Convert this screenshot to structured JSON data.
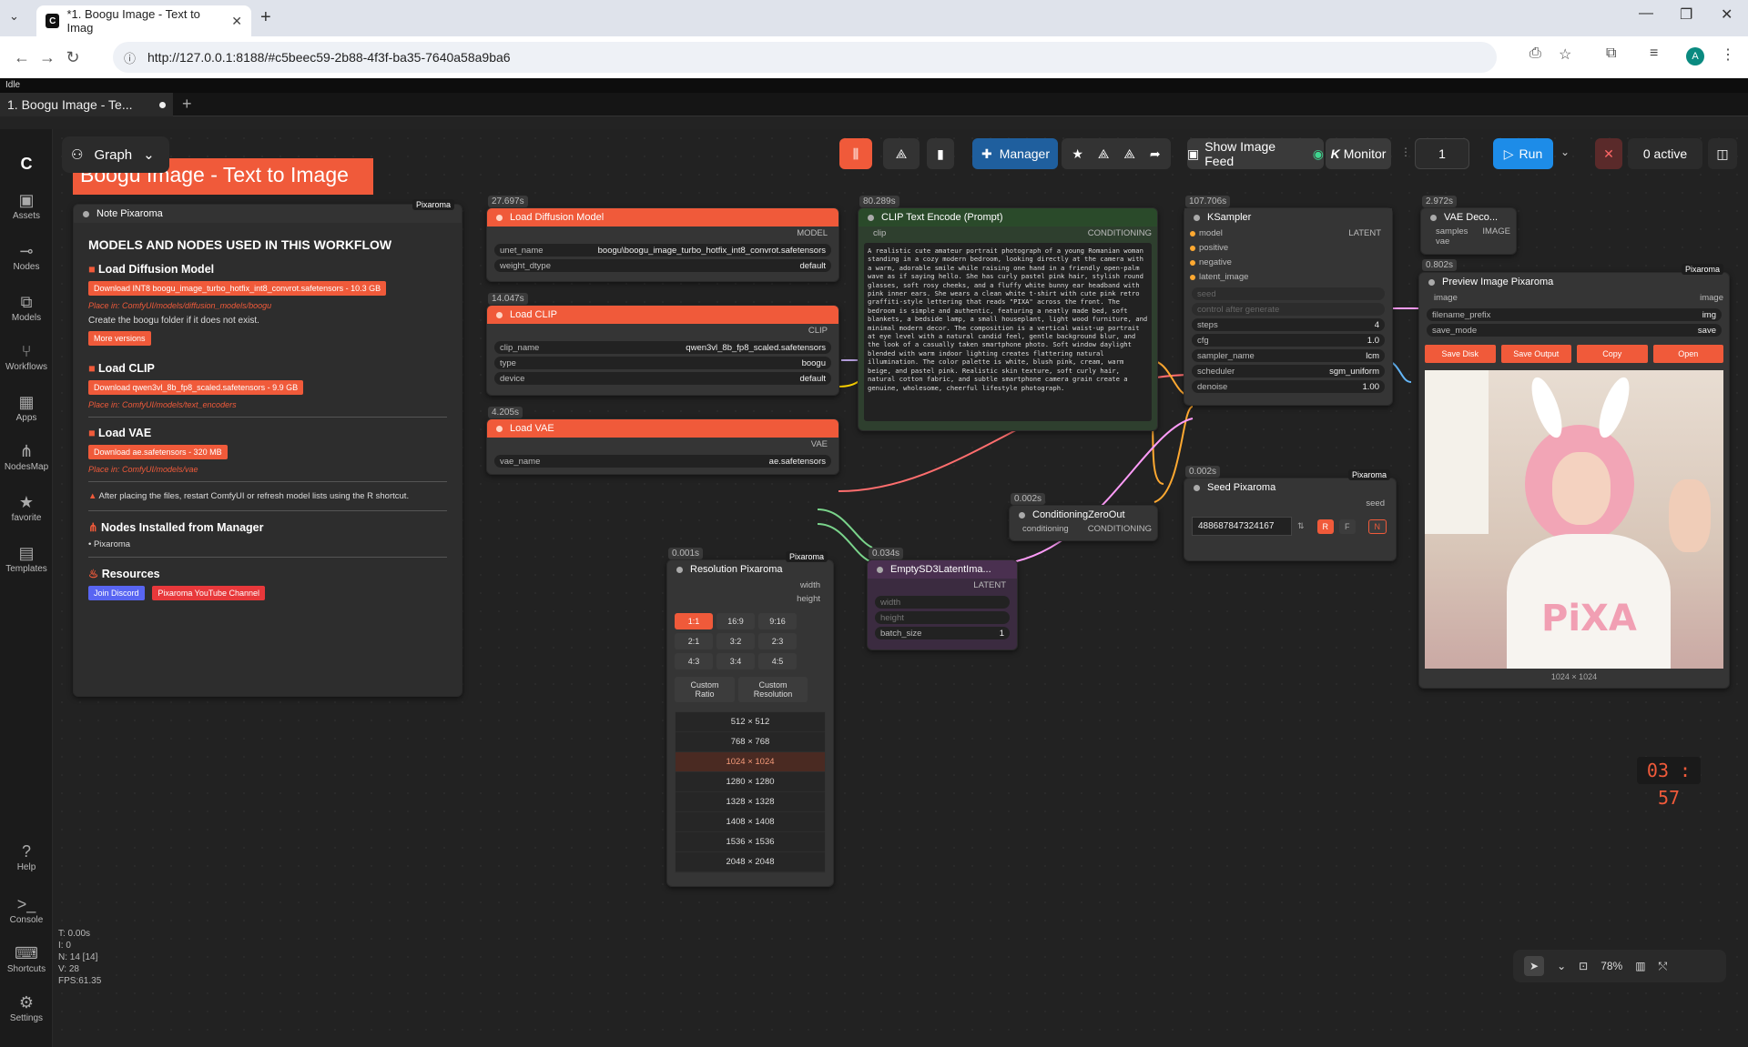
{
  "browser": {
    "tab_title": "*1. Boogu Image - Text to Imag",
    "url": "http://127.0.0.1:8188/#c5beec59-2b88-4f3f-ba35-7640a58a9ba6",
    "profile_initial": "A"
  },
  "app": {
    "status": "Idle",
    "workflow_tab": "1. Boogu Image - Te...",
    "mode": "Graph",
    "group_title": "Boogu Image - Text to Image"
  },
  "sidebar": [
    {
      "label": "Assets",
      "icon": "assets-icon"
    },
    {
      "label": "Nodes",
      "icon": "nodes-icon"
    },
    {
      "label": "Models",
      "icon": "models-icon"
    },
    {
      "label": "Workflows",
      "icon": "workflows-icon"
    },
    {
      "label": "Apps",
      "icon": "apps-icon"
    },
    {
      "label": "NodesMap",
      "icon": "nodesmap-icon"
    },
    {
      "label": "favorite",
      "icon": "star-icon"
    },
    {
      "label": "Templates",
      "icon": "templates-icon"
    },
    {
      "label": "Help",
      "icon": "help-icon"
    },
    {
      "label": "Console",
      "icon": "console-icon"
    },
    {
      "label": "Shortcuts",
      "icon": "keyboard-icon"
    },
    {
      "label": "Settings",
      "icon": "gear-icon"
    }
  ],
  "toolbar": {
    "manager": "Manager",
    "show_feed": "Show Image Feed",
    "monitor": "Monitor",
    "queue_count": "1",
    "run": "Run",
    "active": "0 active"
  },
  "note": {
    "title": "Note Pixaroma",
    "badge": "Pixaroma",
    "heading": "MODELS AND NODES USED IN THIS WORKFLOW",
    "s1_title": "Load Diffusion Model",
    "s1_dl": "Download INT8 boogu_image_turbo_hotfix_int8_convrot.safetensors - 10.3 GB",
    "s1_place": "Place in: ComfyUI/models/diffusion_models/boogu",
    "s1_create": "Create the  boogu  folder if it does not exist.",
    "s1_more": "More versions",
    "s2_title": "Load CLIP",
    "s2_dl": "Download qwen3vl_8b_fp8_scaled.safetensors - 9.9 GB",
    "s2_place": "Place in: ComfyUI/models/text_encoders",
    "s3_title": "Load VAE",
    "s3_dl": "Download ae.safetensors - 320 MB",
    "s3_place": "Place in: ComfyUI/models/vae",
    "warn": "After placing the files, restart ComfyUI or refresh model lists using the R shortcut.",
    "s4_title": "Nodes Installed from Manager",
    "s4_item": "Pixaroma",
    "s5_title": "Resources",
    "discord": "Join Discord",
    "youtube": "Pixaroma YouTube Channel"
  },
  "nodes": {
    "diff": {
      "time": "27.697s",
      "title": "Load Diffusion Model",
      "out": "MODEL",
      "w1_name": "unet_name",
      "w1_val": "boogu\\boogu_image_turbo_hotfix_int8_convrot.safetensors",
      "w2_name": "weight_dtype",
      "w2_val": "default"
    },
    "clip": {
      "time": "14.047s",
      "title": "Load CLIP",
      "out": "CLIP",
      "w1_name": "clip_name",
      "w1_val": "qwen3vl_8b_fp8_scaled.safetensors",
      "w2_name": "type",
      "w2_val": "boogu",
      "w3_name": "device",
      "w3_val": "default"
    },
    "vae": {
      "time": "4.205s",
      "title": "Load VAE",
      "out": "VAE",
      "w1_name": "vae_name",
      "w1_val": "ae.safetensors"
    },
    "enc": {
      "time": "80.289s",
      "title": "CLIP Text Encode (Prompt)",
      "in": "clip",
      "out": "CONDITIONING",
      "prompt": "A realistic cute amateur portrait photograph of a young Romanian woman standing in a cozy modern bedroom, looking directly at the camera with a warm, adorable smile while raising one hand in a friendly open-palm wave as if saying hello. She has curly pastel pink hair, stylish round glasses, soft rosy cheeks, and a fluffy white bunny ear headband with pink inner ears. She wears a clean white t-shirt with cute pink retro graffiti-style lettering that reads \"PIXA\" across the front. The bedroom is simple and authentic, featuring a neatly made bed, soft blankets, a bedside lamp, a small houseplant, light wood furniture, and minimal modern decor. The composition is a vertical waist-up portrait at eye level with a natural candid feel, gentle background blur, and the look of a casually taken smartphone photo. Soft window daylight blended with warm indoor lighting creates flattering natural illumination. The color palette is white, blush pink, cream, warm beige, and pastel pink. Realistic skin texture, soft curly hair, natural cotton fabric, and subtle smartphone camera grain create a genuine, wholesome, cheerful lifestyle photograph."
    },
    "ks": {
      "time": "107.706s",
      "title": "KSampler",
      "out": "LATENT",
      "in1": "model",
      "in2": "positive",
      "in3": "negative",
      "in4": "latent_image",
      "seed": "seed",
      "cag": "control after generate",
      "steps_n": "steps",
      "steps_v": "4",
      "cfg_n": "cfg",
      "cfg_v": "1.0",
      "samp_n": "sampler_name",
      "samp_v": "lcm",
      "sch_n": "scheduler",
      "sch_v": "sgm_uniform",
      "den_n": "denoise",
      "den_v": "1.00"
    },
    "vaed": {
      "time": "2.972s",
      "title": "VAE Deco...",
      "in1": "samples",
      "in2": "vae",
      "out": "IMAGE"
    },
    "prev": {
      "time": "0.802s",
      "badge": "Pixaroma",
      "title": "Preview Image Pixaroma",
      "in": "image",
      "out": "image",
      "w1_name": "filename_prefix",
      "w1_val": "img",
      "w2_name": "save_mode",
      "w2_val": "save",
      "b1": "Save Disk",
      "b2": "Save Output",
      "b3": "Copy",
      "b4": "Open",
      "caption": "1024 × 1024"
    },
    "seed": {
      "time": "0.002s",
      "badge": "Pixaroma",
      "title": "Seed Pixaroma",
      "out": "seed",
      "value": "488687847324167",
      "r": "R",
      "f": "F",
      "n": "N"
    },
    "czo": {
      "time": "0.002s",
      "title": "ConditioningZeroOut",
      "in": "conditioning",
      "out": "CONDITIONING"
    },
    "res": {
      "time": "0.001s",
      "badge": "Pixaroma",
      "title": "Resolution Pixaroma",
      "o1": "width",
      "o2": "height",
      "ratios": [
        "1:1",
        "16:9",
        "9:16",
        "2:1",
        "3:2",
        "2:3",
        "4:3",
        "3:4",
        "4:5"
      ],
      "custom1": "Custom Ratio",
      "custom2": "Custom Resolution",
      "sizes": [
        "512 × 512",
        "768 × 768",
        "1024 × 1024",
        "1280 × 1280",
        "1328 × 1328",
        "1408 × 1408",
        "1536 × 1536",
        "2048 × 2048"
      ]
    },
    "lat": {
      "time": "0.034s",
      "title": "EmptySD3LatentIma...",
      "out": "LATENT",
      "w1": "width",
      "w2": "height",
      "w3_name": "batch_size",
      "w3_val": "1"
    }
  },
  "timer": "03 : 57",
  "stats": {
    "t": "T: 0.00s",
    "i": "I: 0",
    "n": "N: 14 [14]",
    "v": "V: 28",
    "fps": "FPS:61.35"
  },
  "zoom": "78%"
}
